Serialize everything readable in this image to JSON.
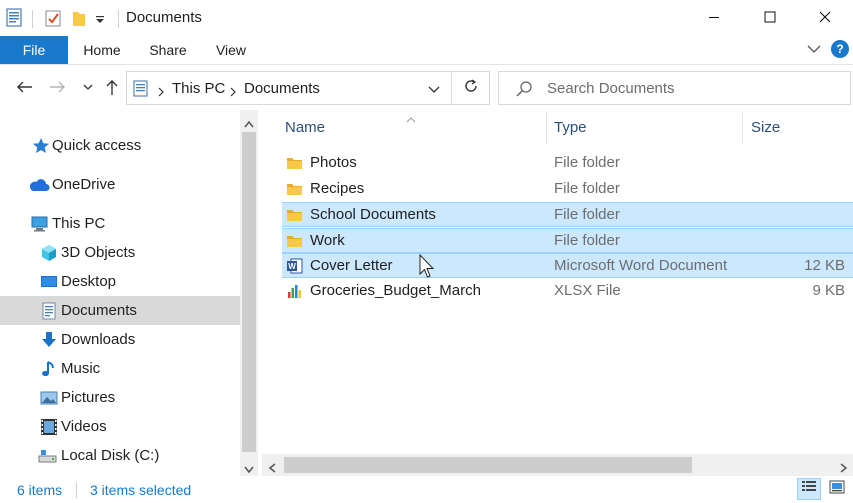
{
  "window": {
    "title": "Documents",
    "minimize_icon": "minimize-icon",
    "maximize_icon": "maximize-icon",
    "close_icon": "close-icon"
  },
  "ribbon": {
    "tabs": [
      "File",
      "Home",
      "Share",
      "View"
    ],
    "help_label": "?"
  },
  "address": {
    "crumbs": [
      "This PC",
      "Documents"
    ],
    "search_placeholder": "Search Documents"
  },
  "nav": {
    "items": [
      {
        "label": "Quick access",
        "icon": "star-icon"
      },
      {
        "label": "OneDrive",
        "icon": "cloud-icon"
      },
      {
        "label": "This PC",
        "icon": "computer-icon"
      },
      {
        "label": "3D Objects",
        "icon": "cube-icon"
      },
      {
        "label": "Desktop",
        "icon": "desktop-icon"
      },
      {
        "label": "Documents",
        "icon": "document-icon",
        "selected": true
      },
      {
        "label": "Downloads",
        "icon": "download-arrow-icon"
      },
      {
        "label": "Music",
        "icon": "music-note-icon"
      },
      {
        "label": "Pictures",
        "icon": "picture-icon"
      },
      {
        "label": "Videos",
        "icon": "film-icon"
      },
      {
        "label": "Local Disk (C:)",
        "icon": "drive-icon"
      }
    ]
  },
  "columns": {
    "name": "Name",
    "type": "Type",
    "size": "Size"
  },
  "files": [
    {
      "name": "Photos",
      "type": "File folder",
      "size": "",
      "icon": "folder-icon",
      "state": "normal"
    },
    {
      "name": "Recipes",
      "type": "File folder",
      "size": "",
      "icon": "folder-icon",
      "state": "normal"
    },
    {
      "name": "School Documents",
      "type": "File folder",
      "size": "",
      "icon": "folder-icon",
      "state": "selected"
    },
    {
      "name": "Work",
      "type": "File folder",
      "size": "",
      "icon": "folder-icon",
      "state": "selected"
    },
    {
      "name": "Cover Letter",
      "type": "Microsoft Word Document",
      "size": "12 KB",
      "icon": "word-document-icon",
      "state": "hover-selected"
    },
    {
      "name": "Groceries_Budget_March",
      "type": "XLSX File",
      "size": "9 KB",
      "icon": "spreadsheet-icon",
      "state": "normal"
    }
  ],
  "status": {
    "item_count": "6 items",
    "selection": "3 items selected"
  },
  "colors": {
    "accent": "#1979ca",
    "selection": "#cce8ff",
    "selection_border": "#99d1ff",
    "folder": "#f8c948"
  }
}
